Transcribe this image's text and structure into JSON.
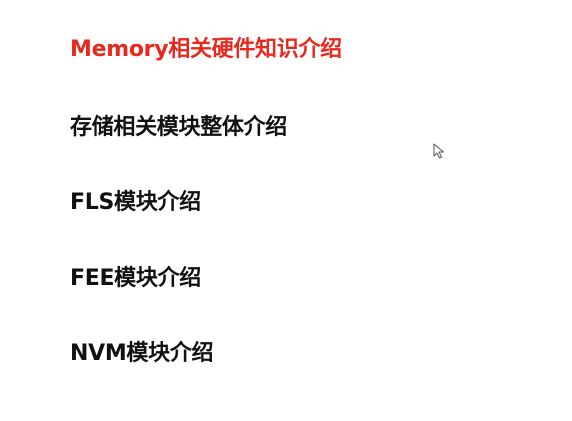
{
  "agenda": {
    "items": [
      {
        "label": "Memory相关硬件知识介绍",
        "active": true
      },
      {
        "label": "存储相关模块整体介绍",
        "active": false
      },
      {
        "label": "FLS模块介绍",
        "active": false
      },
      {
        "label": "FEE模块介绍",
        "active": false
      },
      {
        "label": "NVM模块介绍",
        "active": false
      }
    ]
  },
  "colors": {
    "active": "#e8291d",
    "text": "#111111",
    "background": "#ffffff"
  },
  "icons": {
    "cursor": "mouse-pointer-icon"
  }
}
